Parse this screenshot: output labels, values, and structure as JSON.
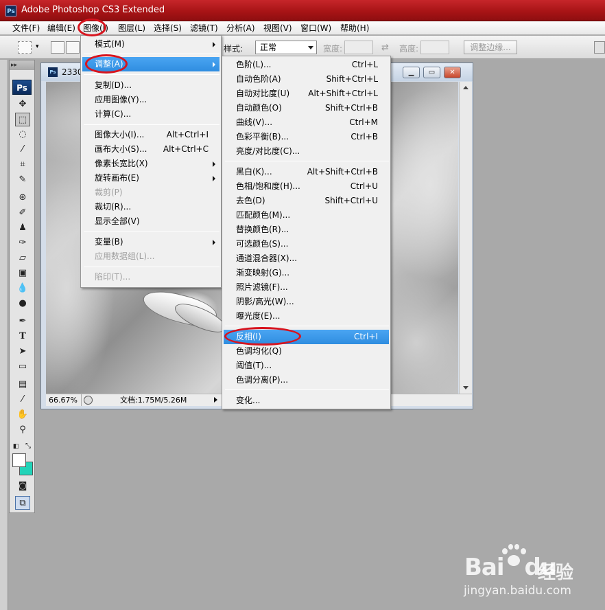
{
  "window": {
    "title": "Adobe Photoshop CS3 Extended",
    "logo": "Ps"
  },
  "menubar": [
    {
      "label": "文件(F)"
    },
    {
      "label": "编辑(E)"
    },
    {
      "label": "图像(I)"
    },
    {
      "label": "图层(L)"
    },
    {
      "label": "选择(S)"
    },
    {
      "label": "滤镜(T)"
    },
    {
      "label": "分析(A)"
    },
    {
      "label": "视图(V)"
    },
    {
      "label": "窗口(W)"
    },
    {
      "label": "帮助(H)"
    }
  ],
  "options": {
    "style_label": "样式:",
    "style_value": "正常",
    "width_label": "宽度:",
    "height_label": "高度:",
    "refine_button": "调整边缘..."
  },
  "toolpanel": {
    "logo": "Ps",
    "grip": "▸▸"
  },
  "document": {
    "name": "2330",
    "icon": "Ps",
    "zoom": "66.67%",
    "doc_info": "文档:1.75M/5.26M"
  },
  "image_menu": [
    {
      "label": "模式(M)",
      "submenu": true
    },
    {
      "label": "调整(A)",
      "submenu": true,
      "highlighted": true
    },
    {
      "label": "复制(D)..."
    },
    {
      "label": "应用图像(Y)..."
    },
    {
      "label": "计算(C)..."
    },
    {
      "label": "图像大小(I)...",
      "shortcut": "Alt+Ctrl+I"
    },
    {
      "label": "画布大小(S)...",
      "shortcut": "Alt+Ctrl+C"
    },
    {
      "label": "像素长宽比(X)",
      "submenu": true
    },
    {
      "label": "旋转画布(E)",
      "submenu": true
    },
    {
      "label": "裁剪(P)",
      "disabled": true
    },
    {
      "label": "裁切(R)..."
    },
    {
      "label": "显示全部(V)"
    },
    {
      "label": "变量(B)",
      "submenu": true
    },
    {
      "label": "应用数据组(L)...",
      "disabled": true
    },
    {
      "label": "陷印(T)...",
      "disabled": true
    }
  ],
  "adjust_menu": [
    {
      "label": "色阶(L)...",
      "shortcut": "Ctrl+L"
    },
    {
      "label": "自动色阶(A)",
      "shortcut": "Shift+Ctrl+L"
    },
    {
      "label": "自动对比度(U)",
      "shortcut": "Alt+Shift+Ctrl+L"
    },
    {
      "label": "自动颜色(O)",
      "shortcut": "Shift+Ctrl+B"
    },
    {
      "label": "曲线(V)...",
      "shortcut": "Ctrl+M"
    },
    {
      "label": "色彩平衡(B)...",
      "shortcut": "Ctrl+B"
    },
    {
      "label": "亮度/对比度(C)..."
    },
    {
      "label": "黑白(K)...",
      "shortcut": "Alt+Shift+Ctrl+B"
    },
    {
      "label": "色相/饱和度(H)...",
      "shortcut": "Ctrl+U"
    },
    {
      "label": "去色(D)",
      "shortcut": "Shift+Ctrl+U"
    },
    {
      "label": "匹配颜色(M)..."
    },
    {
      "label": "替换颜色(R)..."
    },
    {
      "label": "可选颜色(S)..."
    },
    {
      "label": "通道混合器(X)..."
    },
    {
      "label": "渐变映射(G)..."
    },
    {
      "label": "照片滤镜(F)..."
    },
    {
      "label": "阴影/高光(W)..."
    },
    {
      "label": "曝光度(E)..."
    },
    {
      "label": "反相(I)",
      "shortcut": "Ctrl+I",
      "highlighted": true
    },
    {
      "label": "色调均化(Q)"
    },
    {
      "label": "阈值(T)..."
    },
    {
      "label": "色调分离(P)..."
    },
    {
      "label": "变化..."
    }
  ],
  "watermark": {
    "brand": "Bai",
    "brand_suffix": "du",
    "brand_cn": "经验",
    "url": "jingyan.baidu.com"
  },
  "colors": {
    "accent_highlight": "#3393e6",
    "annotation_red": "#d8141e",
    "titlebar_red": "#a81416",
    "background_swatch": "#22d3b8"
  }
}
